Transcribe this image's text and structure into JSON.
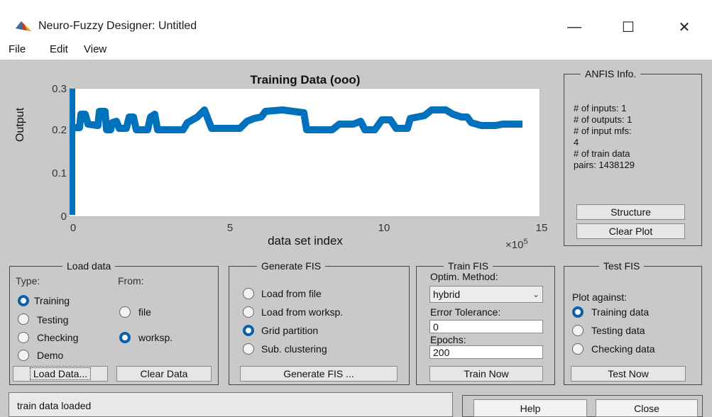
{
  "window": {
    "title": "Neuro-Fuzzy Designer: Untitled",
    "minimize": "—",
    "maximize": "☐",
    "close": "✕"
  },
  "menu": [
    "File",
    "Edit",
    "View"
  ],
  "plot": {
    "title": "Training Data (ooo)",
    "ylabel": "Output",
    "xlabel": "data set index",
    "yticks": [
      "0.3",
      "0.2",
      "0.1",
      "0"
    ],
    "xticks": [
      "0",
      "5",
      "10",
      "15"
    ],
    "xscale_base": "×10",
    "xscale_exp": "5",
    "marker_color": "#0072bd"
  },
  "anfis_info": {
    "title": "ANFIS Info.",
    "lines": [
      "# of inputs: 1",
      "# of outputs: 1",
      "# of input mfs:",
      "4",
      "# of train data",
      "pairs: 1438129"
    ],
    "structure_button": "Structure",
    "clear_plot_button": "Clear Plot"
  },
  "load_data": {
    "title": "Load data",
    "type_label": "Type:",
    "from_label": "From:",
    "types": [
      "Training",
      "Testing",
      "Checking",
      "Demo"
    ],
    "selected_type": 0,
    "sources": [
      "file",
      "worksp."
    ],
    "selected_source": 1,
    "load_button": "Load Data...",
    "clear_button": "Clear Data"
  },
  "generate_fis": {
    "title": "Generate FIS",
    "options": [
      "Load from file",
      "Load from worksp.",
      "Grid partition",
      "Sub. clustering"
    ],
    "selected": 2,
    "button": "Generate FIS ..."
  },
  "train_fis": {
    "title": "Train FIS",
    "optim_label": "Optim. Method:",
    "optim_value": "hybrid",
    "error_label": "Error Tolerance:",
    "error_value": "0",
    "epochs_label": "Epochs:",
    "epochs_value": "200",
    "button": "Train Now"
  },
  "test_fis": {
    "title": "Test FIS",
    "plot_against_label": "Plot against:",
    "options": [
      "Training data",
      "Testing data",
      "Checking data"
    ],
    "selected": 0,
    "button": "Test Now"
  },
  "status": "train data loaded",
  "help_button": "Help",
  "close_button": "Close"
}
